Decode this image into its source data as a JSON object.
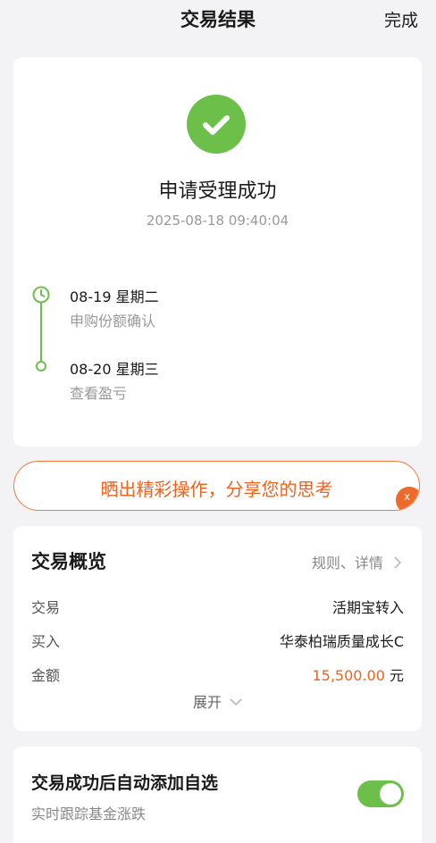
{
  "header": {
    "title": "交易结果",
    "done_label": "完成"
  },
  "result": {
    "title": "申请受理成功",
    "time": "2025-08-18 09:40:04",
    "timeline": [
      {
        "date": "08-19  星期二",
        "desc": "申购份额确认"
      },
      {
        "date": "08-20  星期三",
        "desc": "查看盈亏"
      }
    ]
  },
  "share": {
    "label": "晒出精彩操作，分享您的思考",
    "close": "x"
  },
  "overview": {
    "title": "交易概览",
    "link": "规则、详情",
    "rows": [
      {
        "key": "交易",
        "value": "活期宝转入"
      },
      {
        "key": "买入",
        "value": "华泰柏瑞质量成长C"
      },
      {
        "key": "金额",
        "value": "15,500.00",
        "unit": "元"
      }
    ],
    "expand": "展开"
  },
  "auto_add": {
    "title": "交易成功后自动添加自选",
    "subtitle": "实时跟踪基金涨跌",
    "enabled": true
  },
  "colors": {
    "accent_green": "#6cc04a",
    "accent_orange": "#f0621e"
  }
}
